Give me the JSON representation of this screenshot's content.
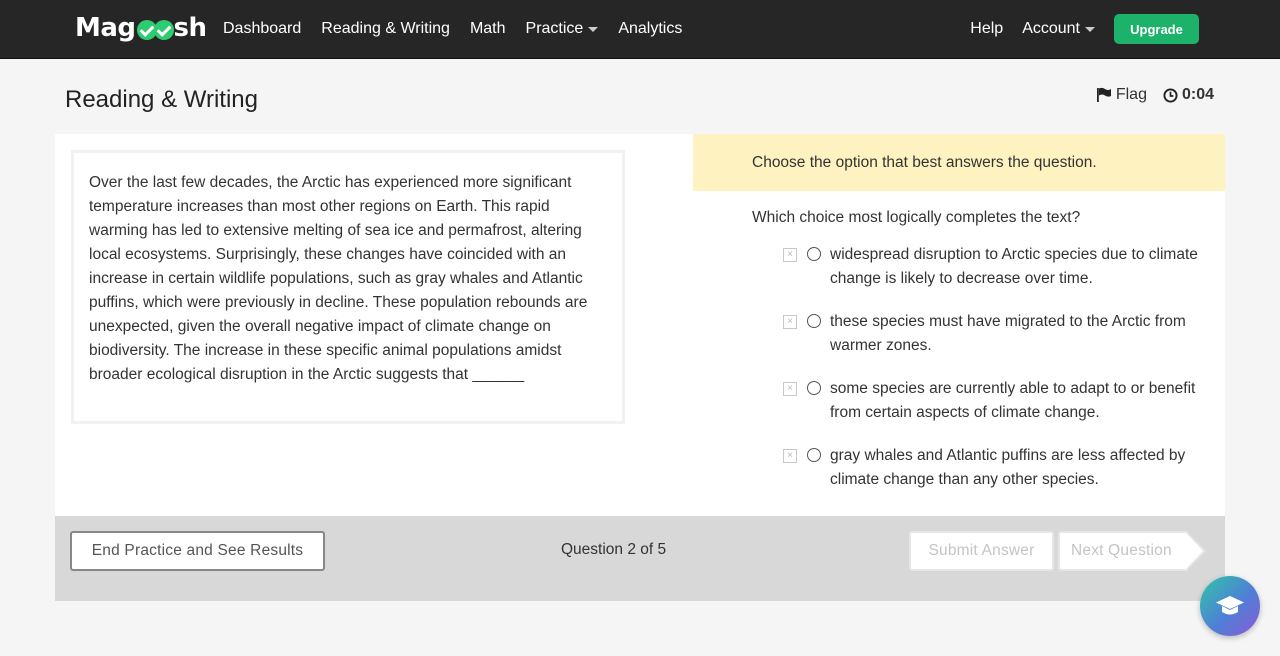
{
  "nav": {
    "brand": "Magoosh",
    "links": [
      "Dashboard",
      "Reading & Writing",
      "Math",
      "Practice",
      "Analytics"
    ],
    "help": "Help",
    "account": "Account",
    "upgrade": "Upgrade",
    "accent_color": "#1db26a"
  },
  "header": {
    "title": "Reading & Writing",
    "flag_label": "Flag",
    "timer": "0:04"
  },
  "passage": "Over the last few decades, the Arctic has experienced more significant temperature increases than most other regions on Earth. This rapid warming has led to extensive melting of sea ice and permafrost, altering local ecosystems. Surprisingly, these changes have coincided with an increase in certain wildlife populations, such as gray whales and Atlantic puffins, which were previously in decline. These population rebounds are unexpected, given the overall negative impact of climate change on biodiversity. The increase in these specific animal populations amidst broader ecological disruption in the Arctic suggests that ______",
  "question": {
    "instruction": "Choose the option that best answers the question.",
    "stem": "Which choice most logically completes the text?",
    "choices": [
      "widespread disruption to Arctic species due to climate change is likely to decrease over time.",
      "these species must have migrated to the Arctic from warmer zones.",
      "some species are currently able to adapt to or benefit from certain aspects of climate change.",
      "gray whales and Atlantic puffins are less affected by climate change than any other species."
    ]
  },
  "footer": {
    "end_label": "End Practice and See Results",
    "counter": "Question 2 of 5",
    "submit_label": "Submit Answer",
    "next_label": "Next Question"
  },
  "icons": {
    "eliminate": "x-box-icon",
    "help": "graduation-cap-icon"
  }
}
